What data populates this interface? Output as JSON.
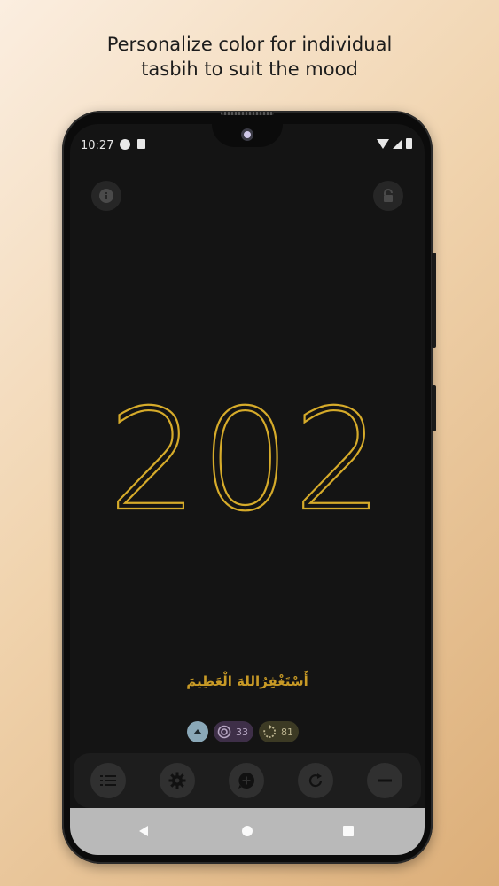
{
  "caption": {
    "line1": "Personalize color  for individual",
    "line2": "tasbih to suit the mood"
  },
  "statusbar": {
    "time": "10:27",
    "icons": [
      "app-notification-icon",
      "sd-card-icon",
      "wifi-icon",
      "signal-icon",
      "battery-icon"
    ]
  },
  "top_buttons": {
    "info_icon": "info-icon",
    "lock_icon": "lock-icon"
  },
  "counter": {
    "value": "202",
    "color": "#d6ab2a"
  },
  "dhikr": {
    "text": "أَسْتَغْفِرُاللهَ الْعَظِيمَ",
    "color": "#c89a26"
  },
  "chips": {
    "collapse_icon": "chevron-up-icon",
    "target_count": "33",
    "rounds_count": "81"
  },
  "bottom_bar": {
    "buttons": [
      "list-icon",
      "gear-icon",
      "add-comment-icon",
      "refresh-icon",
      "minus-icon"
    ]
  },
  "navbar": {
    "buttons": [
      "back-icon",
      "home-icon",
      "recents-icon"
    ]
  }
}
